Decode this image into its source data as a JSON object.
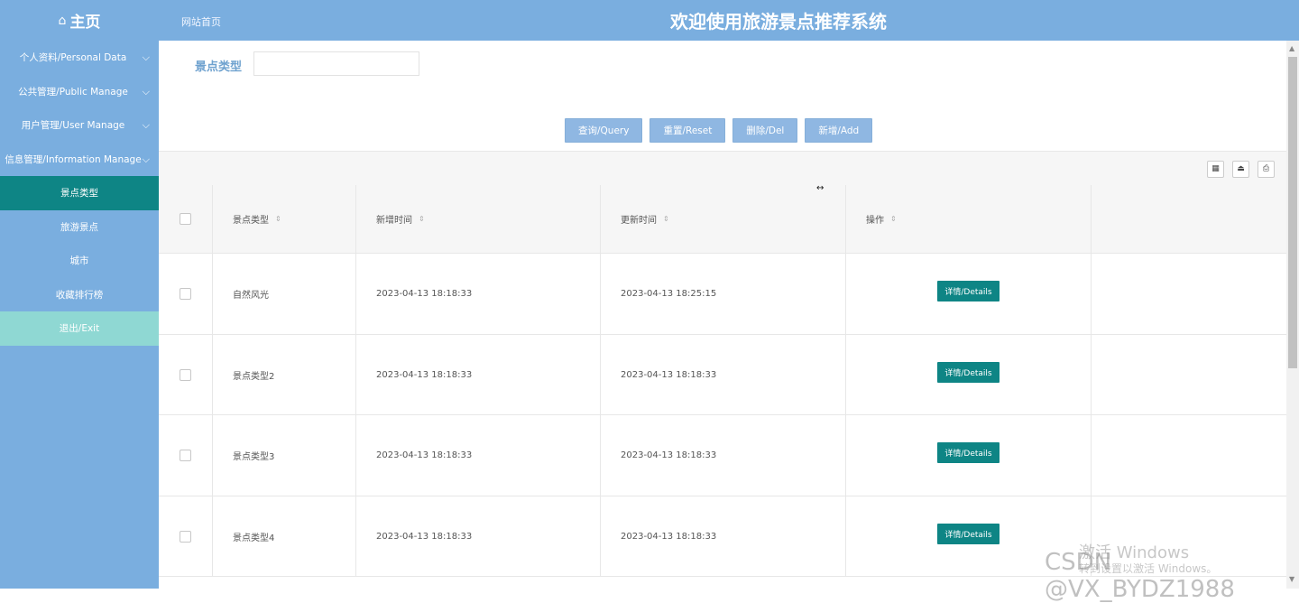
{
  "header": {
    "home_icon": "⌂",
    "brand": "主页",
    "breadcrumb": "网站首页",
    "title": "欢迎使用旅游景点推荐系统"
  },
  "sidebar": {
    "items": [
      {
        "label": "个人资料/Personal Data",
        "group": true
      },
      {
        "label": "公共管理/Public Manage",
        "group": true
      },
      {
        "label": "用户管理/User Manage",
        "group": true
      },
      {
        "label": "信息管理/Information Manage",
        "group": true
      },
      {
        "label": "景点类型",
        "active": true
      },
      {
        "label": "旅游景点"
      },
      {
        "label": "城市"
      },
      {
        "label": "收藏排行榜"
      },
      {
        "label": "退出/Exit"
      }
    ]
  },
  "search": {
    "label": "景点类型",
    "value": ""
  },
  "buttons": {
    "query": "查询/Query",
    "reset": "重置/Reset",
    "del": "删除/Del",
    "add": "新增/Add"
  },
  "table": {
    "columns": [
      "景点类型",
      "新增时间",
      "更新时间",
      "操作"
    ],
    "sort_icon": "⇕",
    "details_label": "详情/Details",
    "rows": [
      {
        "type": "自然风光",
        "created": "2023-04-13 18:18:33",
        "updated": "2023-04-13 18:25:15"
      },
      {
        "type": "景点类型2",
        "created": "2023-04-13 18:18:33",
        "updated": "2023-04-13 18:18:33"
      },
      {
        "type": "景点类型3",
        "created": "2023-04-13 18:18:33",
        "updated": "2023-04-13 18:18:33"
      },
      {
        "type": "景点类型4",
        "created": "2023-04-13 18:18:33",
        "updated": "2023-04-13 18:18:33"
      }
    ]
  },
  "watermarks": {
    "activate": "激活 Windows",
    "activate_sub": "转到设置以激活 Windows。",
    "csdn": "CSDN @VX_BYDZ1988"
  },
  "colors": {
    "primary": "#7aaedf",
    "active": "#0e8585",
    "exit": "#8fd8d3"
  }
}
